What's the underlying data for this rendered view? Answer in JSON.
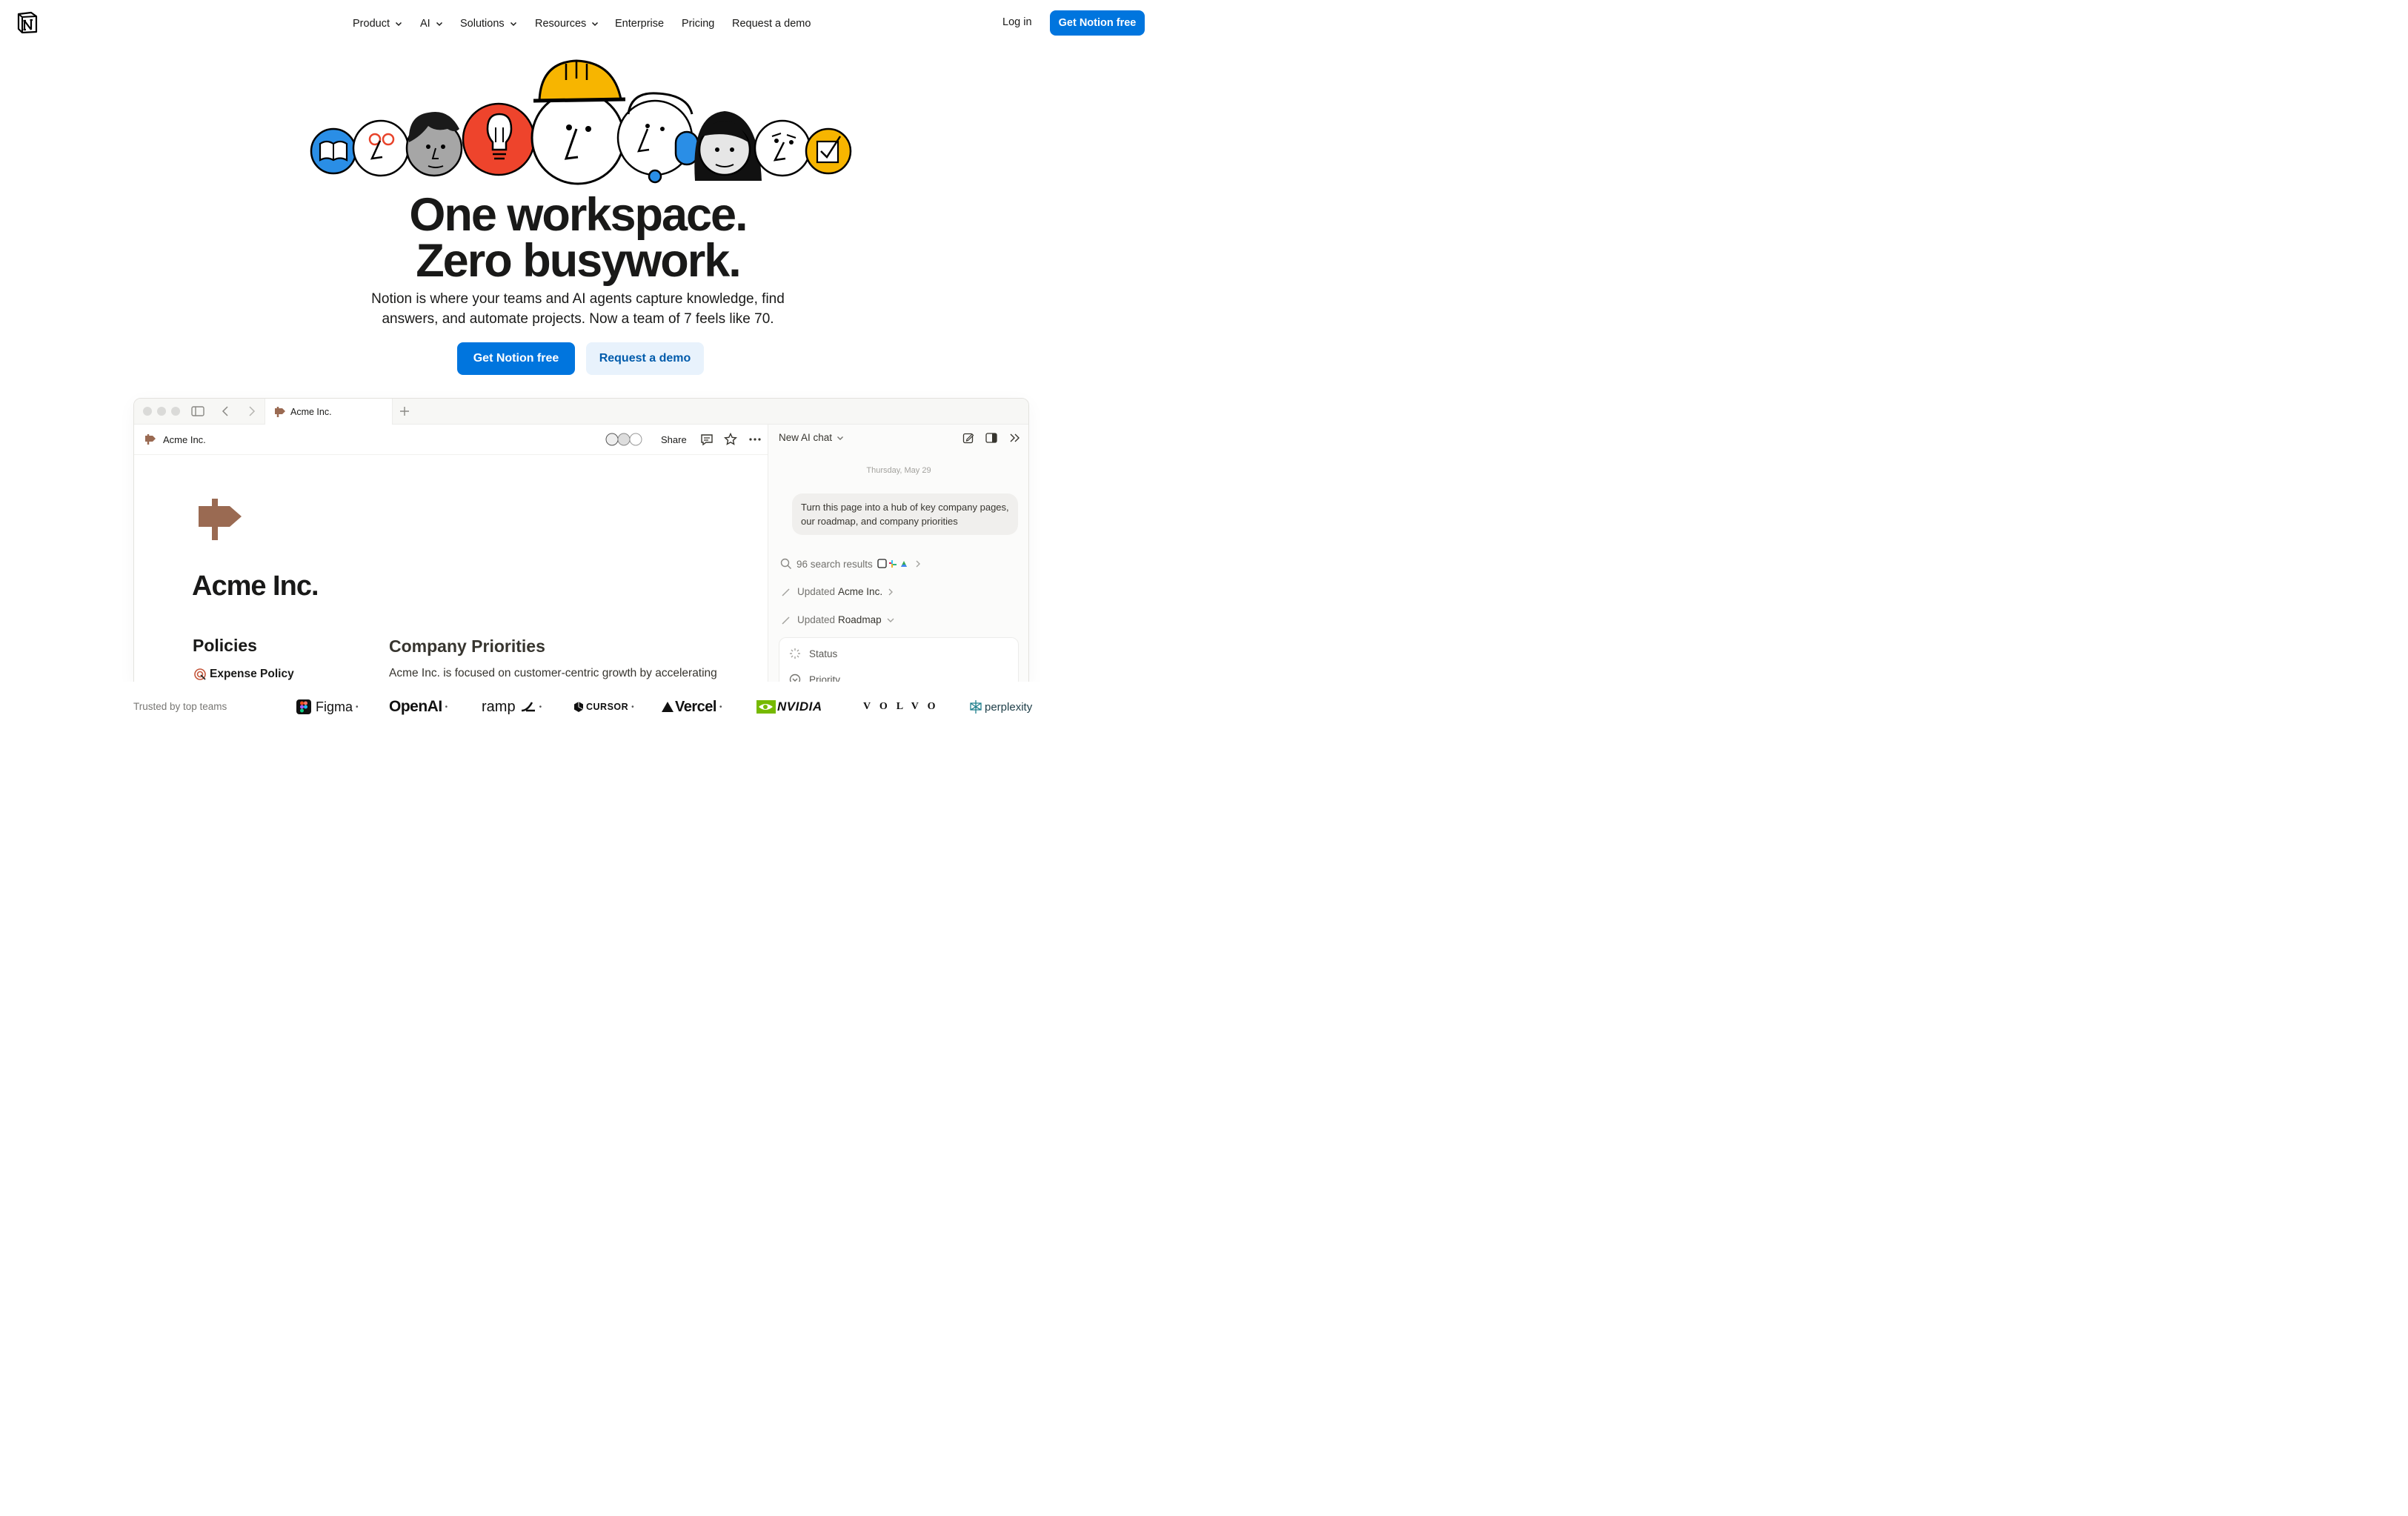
{
  "nav": {
    "items": [
      {
        "label": "Product",
        "dropdown": true
      },
      {
        "label": "AI",
        "dropdown": true
      },
      {
        "label": "Solutions",
        "dropdown": true
      },
      {
        "label": "Resources",
        "dropdown": true
      },
      {
        "label": "Enterprise",
        "dropdown": false
      },
      {
        "label": "Pricing",
        "dropdown": false
      },
      {
        "label": "Request a demo",
        "dropdown": false
      }
    ],
    "login": "Log in",
    "cta": "Get Notion free"
  },
  "hero": {
    "headline_line1": "One workspace.",
    "headline_line2": "Zero busywork.",
    "subtitle_line1": "Notion is where your teams and AI agents capture knowledge, find",
    "subtitle_line2": "answers, and automate projects. Now a team of 7 feels like 70.",
    "primary_button": "Get Notion free",
    "secondary_button": "Request a demo"
  },
  "app": {
    "tab_title": "Acme Inc.",
    "breadcrumb": "Acme Inc.",
    "share": "Share",
    "page_title": "Acme Inc.",
    "policies_heading": "Policies",
    "policy_item": "Expense Policy",
    "priorities_heading": "Company Priorities",
    "priorities_text": "Acme Inc. is focused on customer-centric growth by accelerating"
  },
  "ai_panel": {
    "title": "New AI chat",
    "date": "Thursday, May 29",
    "message": "Turn this page into a hub of key company pages, our roadmap, and company priorities",
    "search_results": "96 search results",
    "updated_prefix": "Updated",
    "updated_1": "Acme Inc.",
    "updated_2": "Roadmap",
    "prop_status": "Status",
    "prop_priority": "Priority"
  },
  "trusted": {
    "label": "Trusted by top teams",
    "brands": [
      "Figma",
      "OpenAI",
      "ramp",
      "CURSOR",
      "Vercel",
      "NVIDIA",
      "VOLVO",
      "perplexity"
    ]
  },
  "colors": {
    "primary": "#0075de",
    "secondary_bg": "#e8f2fc",
    "signpost": "#9a6a52"
  }
}
